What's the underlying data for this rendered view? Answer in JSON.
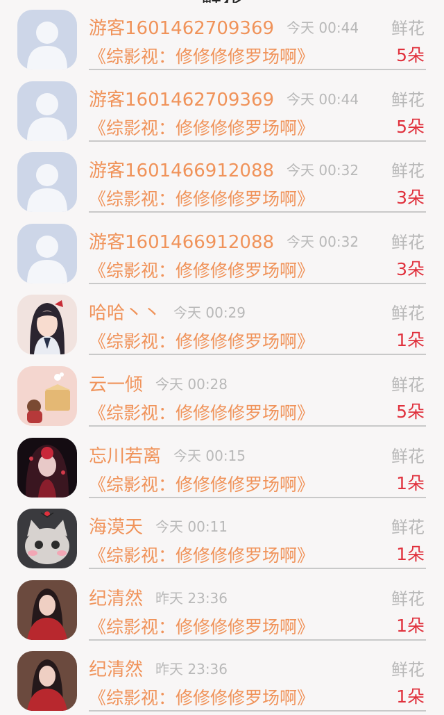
{
  "header": {
    "title": "鲜花"
  },
  "gift_label": "鲜花",
  "rows": [
    {
      "name": "游客1601462709369",
      "time": "今天 00:44",
      "work": "《综影视：修修修修罗场啊》",
      "amount": "5朵",
      "avatar": "default-avatar"
    },
    {
      "name": "游客1601462709369",
      "time": "今天 00:44",
      "work": "《综影视：修修修修罗场啊》",
      "amount": "5朵",
      "avatar": "default-avatar"
    },
    {
      "name": "游客1601466912088",
      "time": "今天 00:32",
      "work": "《综影视：修修修修罗场啊》",
      "amount": "3朵",
      "avatar": "default-avatar"
    },
    {
      "name": "游客1601466912088",
      "time": "今天 00:32",
      "work": "《综影视：修修修修罗场啊》",
      "amount": "3朵",
      "avatar": "default-avatar"
    },
    {
      "name": "哈哈丶丶",
      "time": "今天 00:29",
      "work": "《综影视：修修修修罗场啊》",
      "amount": "1朵",
      "avatar": "anime-girl-avatar"
    },
    {
      "name": "云一倾",
      "time": "今天 00:28",
      "work": "《综影视：修修修修罗场啊》",
      "amount": "5朵",
      "avatar": "illustration-avatar"
    },
    {
      "name": "忘川若离",
      "time": "今天 00:15",
      "work": "《综影视：修修修修罗场啊》",
      "amount": "1朵",
      "avatar": "dark-anime-avatar"
    },
    {
      "name": "海漠天",
      "time": "今天 00:11",
      "work": "《综影视：修修修修罗场啊》",
      "amount": "1朵",
      "avatar": "cat-avatar"
    },
    {
      "name": "纪清然",
      "time": "昨天 23:36",
      "work": "《综影视：修修修修罗场啊》",
      "amount": "1朵",
      "avatar": "red-dress-avatar"
    },
    {
      "name": "纪清然",
      "time": "昨天 23:36",
      "work": "《综影视：修修修修罗场啊》",
      "amount": "1朵",
      "avatar": "red-dress-avatar"
    }
  ]
}
